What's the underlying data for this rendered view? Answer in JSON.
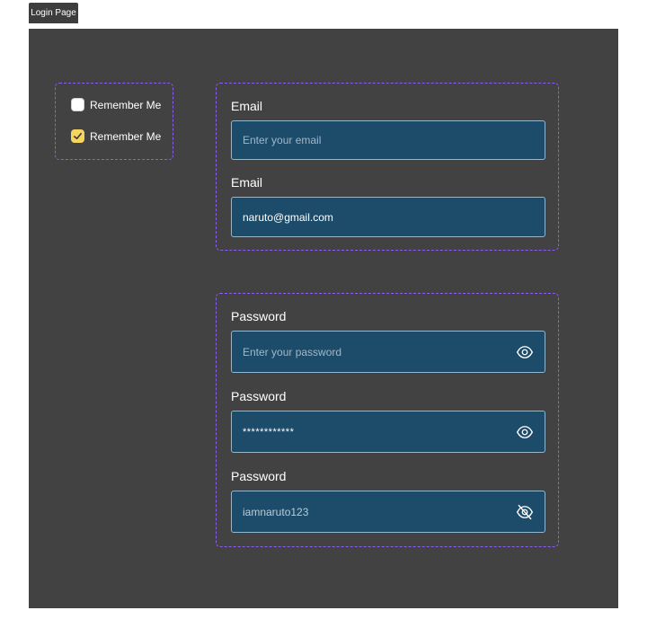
{
  "page_tab": {
    "label": "Login Page"
  },
  "checkboxes": [
    {
      "label": "Remember Me",
      "checked": false
    },
    {
      "label": "Remember Me",
      "checked": true
    }
  ],
  "email_fields": [
    {
      "label": "Email",
      "placeholder": "Enter your email",
      "value": ""
    },
    {
      "label": "Email",
      "placeholder": "",
      "value": "naruto@gmail.com"
    }
  ],
  "password_fields": [
    {
      "label": "Password",
      "placeholder": "Enter your password",
      "value": "",
      "icon": "eye-icon"
    },
    {
      "label": "Password",
      "placeholder": "",
      "value": "************",
      "icon": "eye-icon"
    },
    {
      "label": "Password",
      "placeholder": "",
      "value": "iamnaruto123",
      "icon": "eye-off-icon"
    }
  ],
  "colors": {
    "canvas": "#424242",
    "group_border": "#8b5cf6",
    "field_bg": "#1d4c6a",
    "field_border": "#8fb8d4",
    "checkbox_checked": "#f6d55c"
  }
}
